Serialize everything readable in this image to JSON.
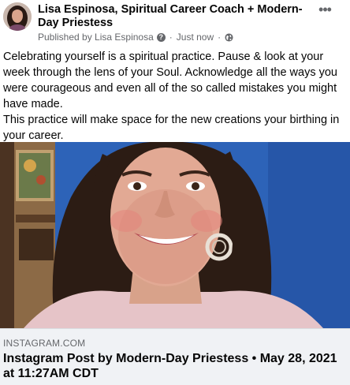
{
  "post": {
    "author": "Lisa Espinosa, Spiritual Career Coach + Modern-Day Priestess",
    "meta": {
      "published_by": "Published by Lisa Espinosa",
      "separator": "·",
      "time": "Just now"
    },
    "body": [
      "Celebrating yourself is a spiritual practice. Pause & look at your week through the lens of your Soul. Acknowledge all the ways you were courageous and even all of the so called mistakes you might have made.",
      "This practice will make space for the new creations your birthing in your career."
    ],
    "link": {
      "domain": "INSTAGRAM.COM",
      "title": "Instagram Post by Modern-Day Priestess • May 28, 2021 at 11:27AM CDT"
    },
    "more_label": "•••"
  },
  "icons": {
    "more": "more-options-icon",
    "meta_question": "question-circle-icon",
    "privacy": "globe-icon"
  },
  "colors": {
    "text": "#050505",
    "secondary_text": "#65676b",
    "link_background": "#f0f2f5",
    "photo_background": "#2b5fb3"
  }
}
